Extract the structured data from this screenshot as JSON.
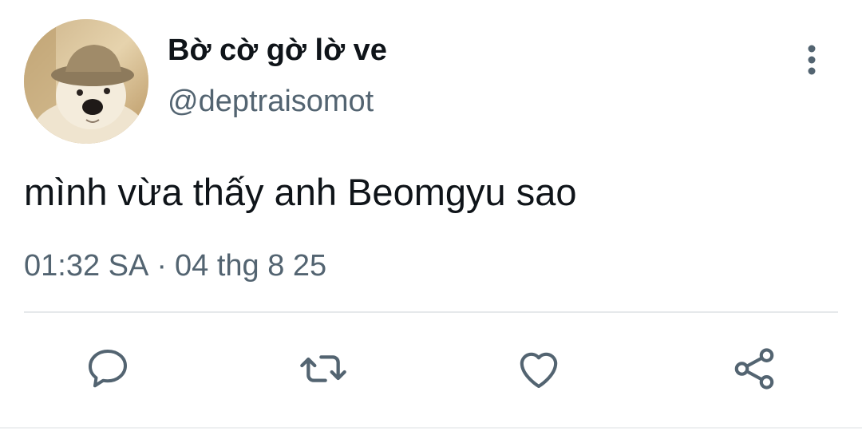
{
  "tweet": {
    "author": {
      "display_name": "Bờ cờ gờ lờ ve",
      "handle": "@deptraisomot"
    },
    "text": "mình vừa thấy anh Beomgyu sao",
    "time": "01:32 SA",
    "separator": "·",
    "date": "04 thg 8 25"
  },
  "icons": {
    "more": "more-vertical-icon",
    "reply": "reply-bubble-icon",
    "retweet": "retweet-icon",
    "like": "heart-icon",
    "share": "share-icon"
  },
  "colors": {
    "text_primary": "#0f1419",
    "text_secondary": "#536471",
    "icon": "#536471",
    "divider": "#e6e9eb"
  }
}
